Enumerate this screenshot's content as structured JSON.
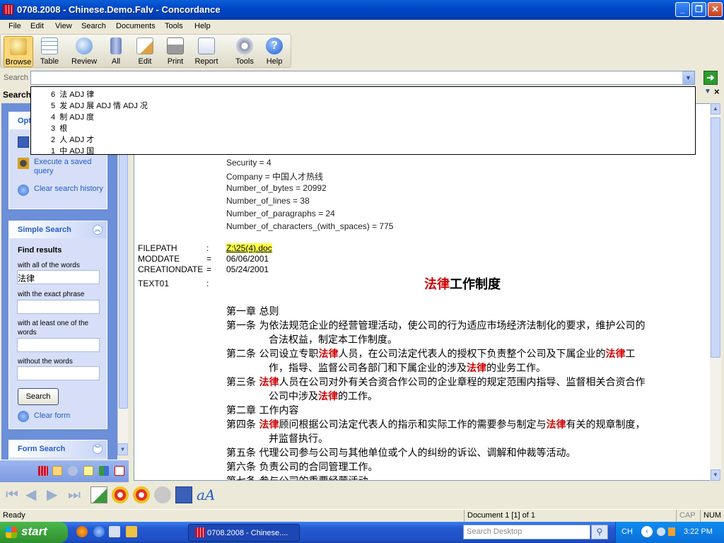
{
  "window": {
    "title": "0708.2008 - Chinese.Demo.Falv - Concordance"
  },
  "menu": [
    "File",
    "Edit",
    "View",
    "Search",
    "Documents",
    "Tools",
    "Help"
  ],
  "toolbar": {
    "buttons": [
      {
        "label": "Browse",
        "icon": "browse-icon"
      },
      {
        "label": "Table",
        "icon": "table-icon"
      },
      {
        "label": "Review",
        "icon": "review-icon"
      },
      {
        "label": "All",
        "icon": "all-icon"
      },
      {
        "label": "Edit",
        "icon": "edit-icon"
      },
      {
        "label": "Print",
        "icon": "print-icon"
      },
      {
        "label": "Report",
        "icon": "report-icon"
      },
      {
        "label": "Tools",
        "icon": "tools-icon"
      },
      {
        "label": "Help",
        "icon": "help-icon"
      }
    ]
  },
  "search": {
    "label": "Search",
    "value": ""
  },
  "dropdown": [
    {
      "count": "6",
      "term": "法 ADJ 律"
    },
    {
      "count": "5",
      "term": "发 ADJ 展 ADJ 情 ADJ 况"
    },
    {
      "count": "4",
      "term": "制 ADJ 度"
    },
    {
      "count": "3",
      "term": "根"
    },
    {
      "count": "2",
      "term": "人 ADJ 才"
    },
    {
      "count": "1",
      "term": "中 ADJ 国"
    }
  ],
  "left_panel": {
    "header": "Search",
    "options_title": "Opt",
    "execute_saved": "Execute a saved query",
    "clear_history": "Clear search history",
    "simple_search": {
      "title": "Simple Search",
      "find_results": "Find results",
      "all_words_label": "with all of the words",
      "all_words_value": "法律",
      "exact_phrase_label": "with the exact phrase",
      "exact_phrase_value": "",
      "at_least_one_label": "with at least one of the words",
      "at_least_one_value": "",
      "without_label": "without the words",
      "without_value": "",
      "search_button": "Search",
      "clear_form": "Clear form"
    },
    "form_search": "Form Search"
  },
  "document": {
    "metadata": [
      "Security = 4",
      "Company = 中国人才热线",
      "Number_of_bytes = 20992",
      "Number_of_lines = 38",
      "Number_of_paragraphs = 24",
      "Number_of_characters_(with_spaces) = 775"
    ],
    "fields": [
      {
        "name": "FILEPATH",
        "sep": ":",
        "value": "Z:\\25(4).doc"
      },
      {
        "name": "MODDATE",
        "sep": "=",
        "value": "06/06/2001"
      },
      {
        "name": "CREATIONDATE",
        "sep": "=",
        "value": "05/24/2001"
      },
      {
        "name": "TEXT01",
        "sep": ":",
        "value": ""
      }
    ],
    "title_hit": "法律",
    "title_rest": "工作制度",
    "body": {
      "l1": "第一章 总则",
      "l2": "第一条  为依法规范企业的经营管理活动，使公司的行为适应市场经济法制化的要求，维护公司的",
      "l3": "合法权益，制定本工作制度。",
      "l4a": "第二条    公司设立专职",
      "hit": "法律",
      "l4b": "人员，在公司法定代表人的授权下负责整个公司及下属企业的",
      "l4c": "工",
      "l5a": "作，指导、监督公司各部门和下属企业的涉及",
      "l5b": "的业务工作。",
      "l6a": "第三条 ",
      "l6b": "人员在公司对外有关合资合作公司的企业章程的规定范围内指导、监督相关合资合作",
      "l7a": "公司中涉及",
      "l7b": "的工作。",
      "l8": "第二章 工作内容",
      "l9a": "第四条 ",
      "l9b": "顾问根据公司法定代表人的指示和实际工作的需要参与制定与",
      "l9c": "有关的规章制度，",
      "l10": "并监督执行。",
      "l11": "第五条 代理公司参与公司与其他单位或个人的纠纷的诉讼、调解和仲裁等活动。",
      "l12": "第六条 负责公司的合同管理工作。",
      "l13": "第七条 参与公司的重要经营活动"
    }
  },
  "statusbar": {
    "ready": "Ready",
    "doc": "Document 1 [1] of 1",
    "cap": "CAP",
    "num": "NUM"
  },
  "taskbar": {
    "start": "start",
    "task": "0708.2008 - Chinese....",
    "desktop_search": "Search Desktop",
    "lang": "CH",
    "time": "3:22 PM"
  }
}
